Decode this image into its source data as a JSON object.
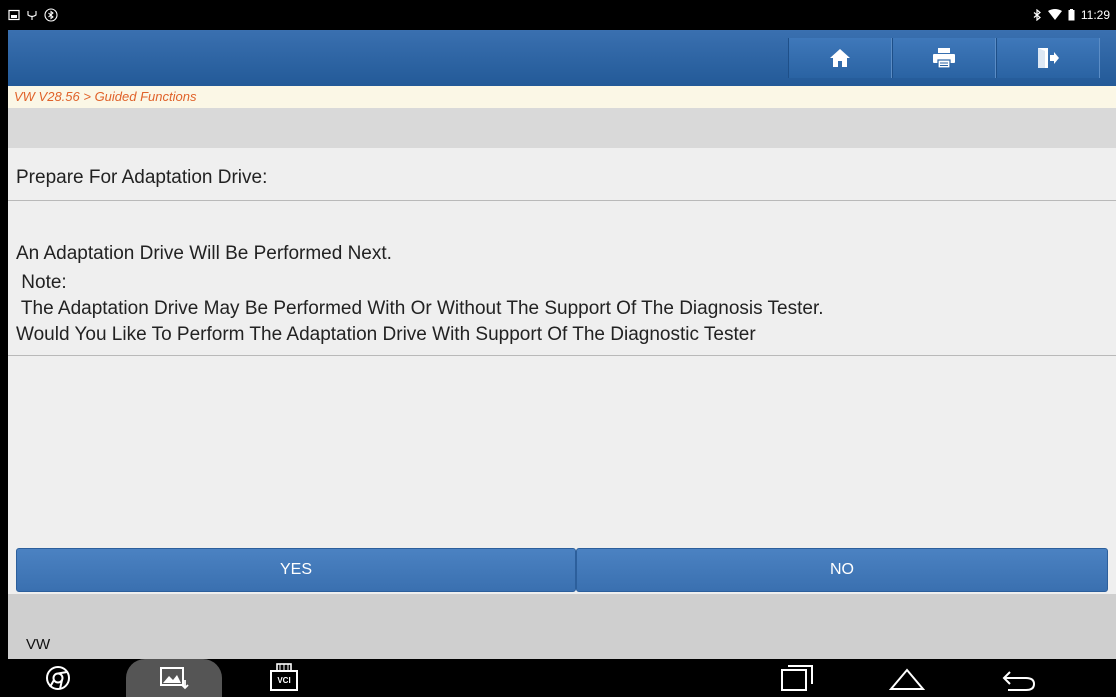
{
  "breadcrumb": "VW V28.56 > Guided Functions",
  "status": {
    "time": "11:29"
  },
  "toolbar": {
    "home_icon": "home-icon",
    "print_icon": "printer-icon",
    "exit_icon": "exit-icon"
  },
  "main": {
    "title": "Prepare For Adaptation Drive:",
    "message_lines": [
      "An Adaptation Drive Will Be Performed Next.",
      " Note:",
      " The Adaptation Drive May Be Performed With Or Without The Support Of The Diagnosis Tester.",
      "Would You Like To Perform The Adaptation Drive With Support Of The Diagnostic Tester"
    ]
  },
  "actions": {
    "yes_label": "YES",
    "no_label": "NO"
  },
  "footer": {
    "label": "VW"
  },
  "nav": {
    "vci_label": "VCI"
  },
  "colors": {
    "toolbar_blue": "#2a63a3",
    "breadcrumb_orange": "#e0622a",
    "button_blue": "#4178b8"
  }
}
